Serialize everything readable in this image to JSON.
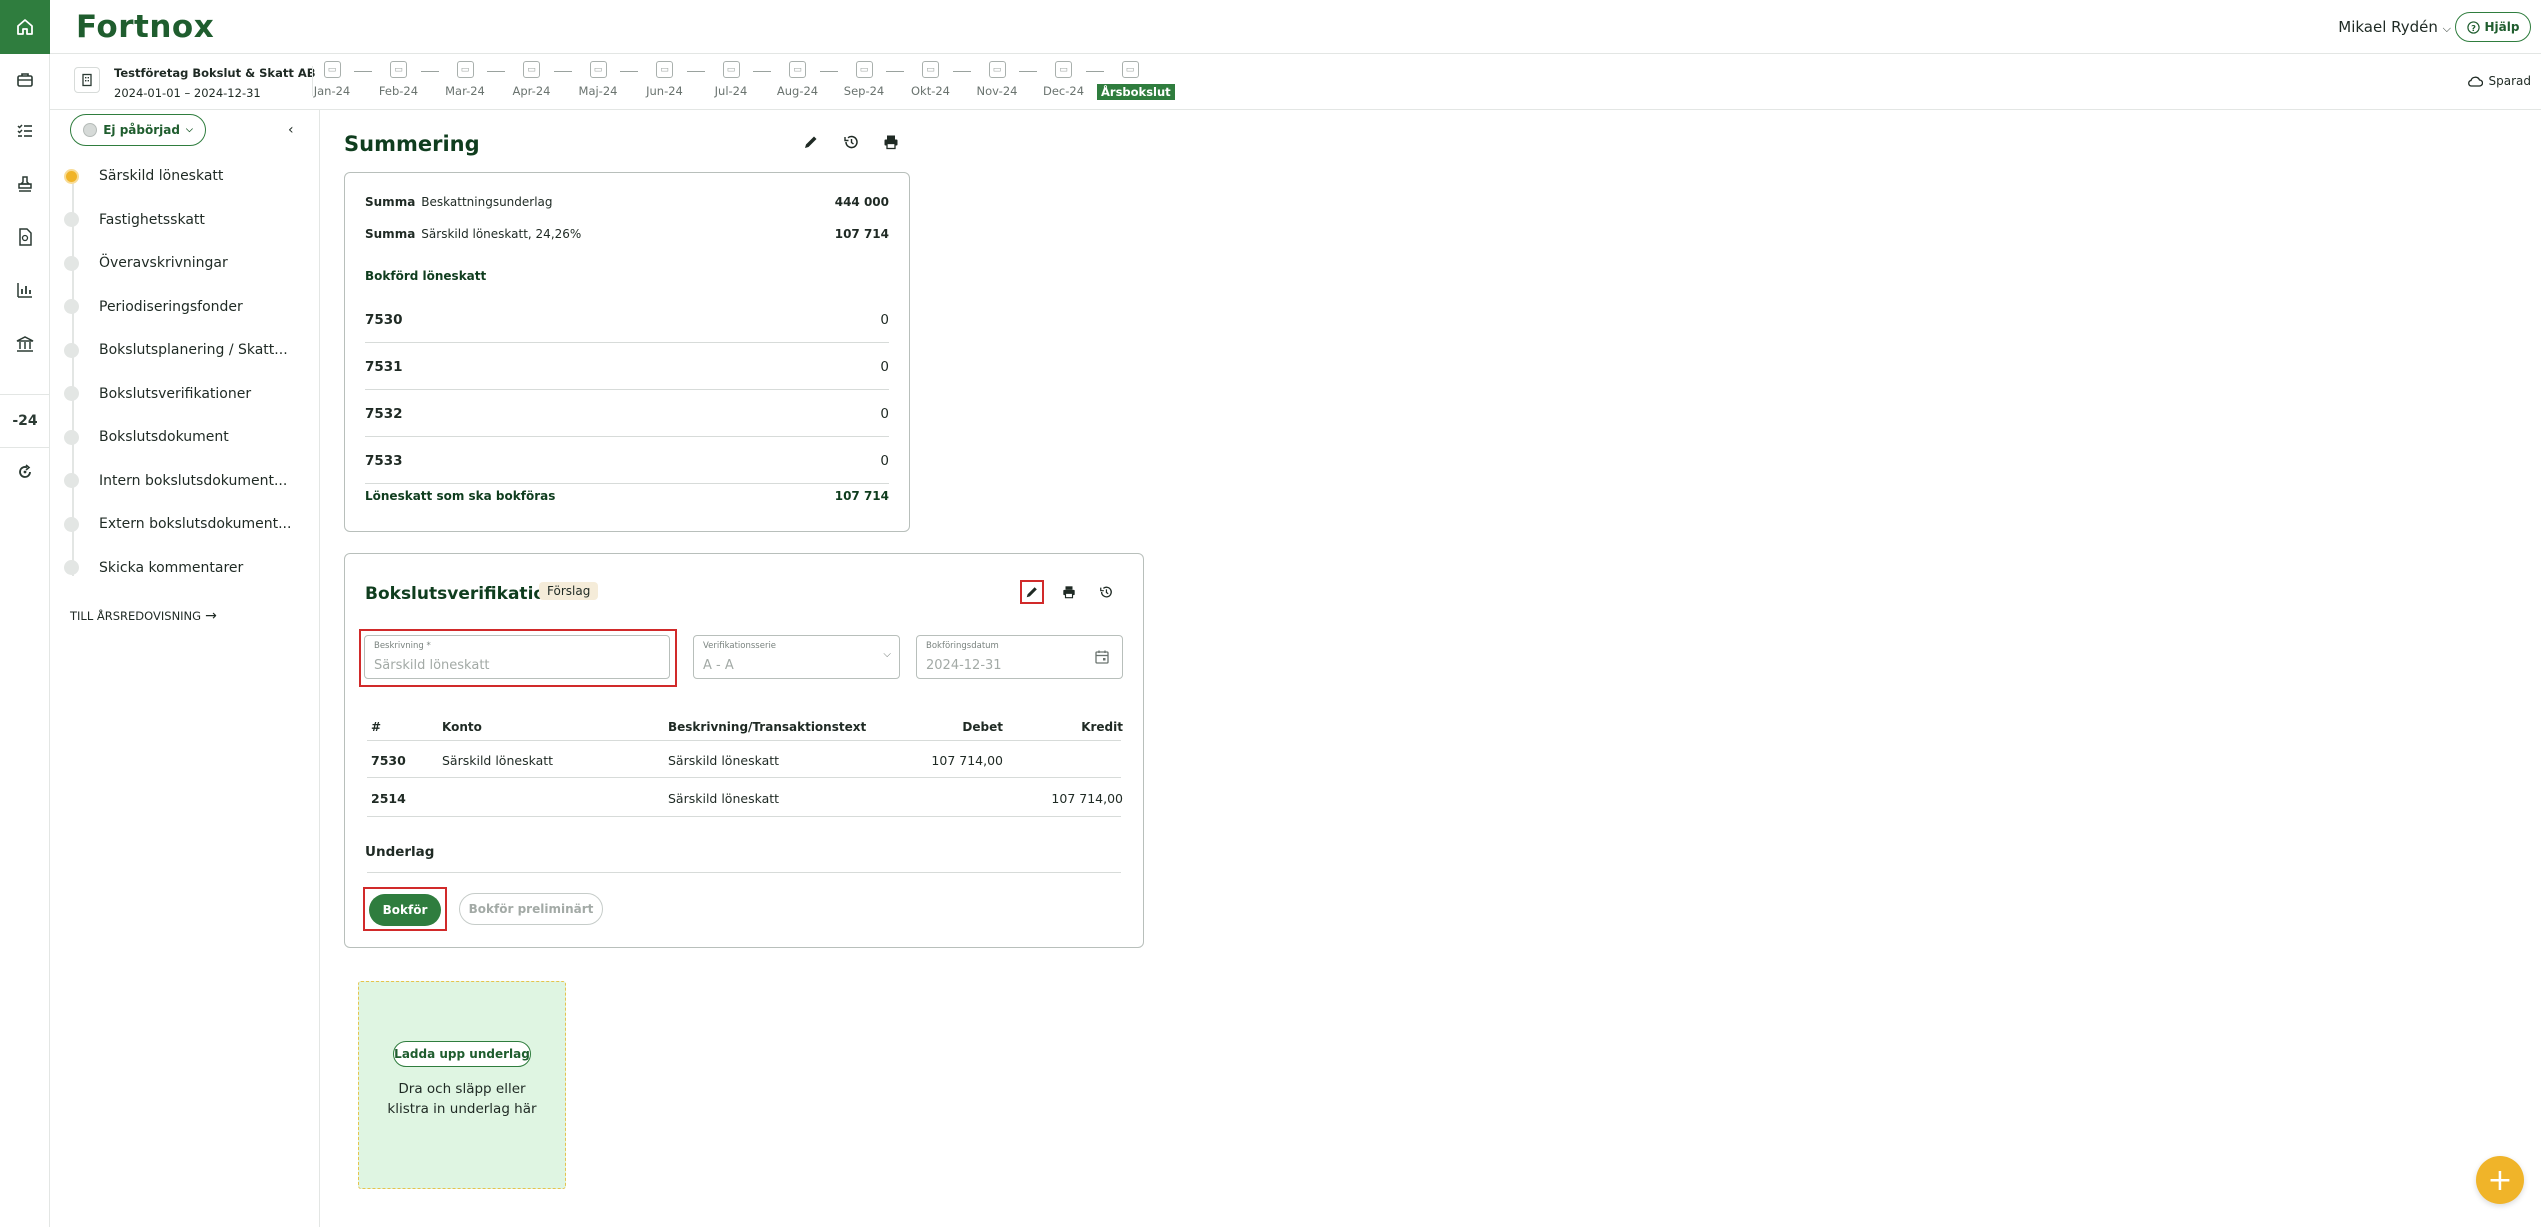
{
  "header": {
    "logo": "Fortnox",
    "user_name": "Mikael Rydén",
    "help_label": "Hjälp"
  },
  "rail": {
    "year_label": "-24"
  },
  "company": {
    "name": "Testföretag Bokslut & Skatt AB",
    "period": "2024-01-01 – 2024-12-31"
  },
  "months": [
    "Jan-24",
    "Feb-24",
    "Mar-24",
    "Apr-24",
    "Maj-24",
    "Jun-24",
    "Jul-24",
    "Aug-24",
    "Sep-24",
    "Okt-24",
    "Nov-24",
    "Dec-24",
    "Årsbokslut"
  ],
  "save_status": "Sparad",
  "sidebar": {
    "status_label": "Ej påbörjad",
    "items": [
      {
        "label": "Särskild löneskatt"
      },
      {
        "label": "Fastighetsskatt"
      },
      {
        "label": "Överavskrivningar"
      },
      {
        "label": "Periodiseringsfonder"
      },
      {
        "label": "Bokslutsplanering / Skatt..."
      },
      {
        "label": "Bokslutsverifikationer"
      },
      {
        "label": "Bokslutsdokument"
      },
      {
        "label": "Intern bokslutsdokument..."
      },
      {
        "label": "Extern bokslutsdokument..."
      },
      {
        "label": "Skicka kommentarer"
      }
    ],
    "link_label": "TILL ÅRSREDOVISNING"
  },
  "summary": {
    "title": "Summering",
    "rows": [
      {
        "prefix": "Summa",
        "label": "Beskattningsunderlag",
        "value": "444 000"
      },
      {
        "prefix": "Summa",
        "label": "Särskild löneskatt, 24,26%",
        "value": "107 714"
      }
    ],
    "section_label": "Bokförd löneskatt",
    "accounts": [
      {
        "number": "7530",
        "value": "0"
      },
      {
        "number": "7531",
        "value": "0"
      },
      {
        "number": "7532",
        "value": "0"
      },
      {
        "number": "7533",
        "value": "0"
      }
    ],
    "total_label": "Löneskatt som ska bokföras",
    "total_value": "107 714"
  },
  "verification": {
    "title": "Bokslutsverifikation",
    "badge": "Förslag",
    "fields": {
      "description_label": "Beskrivning *",
      "description_placeholder": "Särskild löneskatt",
      "series_label": "Verifikationsserie",
      "series_value": "A - A",
      "date_label": "Bokföringsdatum",
      "date_value": "2024-12-31"
    },
    "columns": {
      "num": "#",
      "account": "Konto",
      "text": "Beskrivning/Transaktionstext",
      "debit": "Debet",
      "credit": "Kredit"
    },
    "rows": [
      {
        "num": "7530",
        "account": "Särskild löneskatt",
        "text": "Särskild löneskatt",
        "debit": "107 714,00",
        "credit": ""
      },
      {
        "num": "2514",
        "account": "",
        "text": "Särskild löneskatt",
        "debit": "",
        "credit": "107 714,00"
      }
    ],
    "attachments_label": "Underlag",
    "book_label": "Bokför",
    "book_prelim_label": "Bokför preliminärt"
  },
  "dropzone": {
    "upload_label": "Ladda upp underlag",
    "text": "Dra och släpp eller klistra in underlag här"
  },
  "fab_label": "+"
}
